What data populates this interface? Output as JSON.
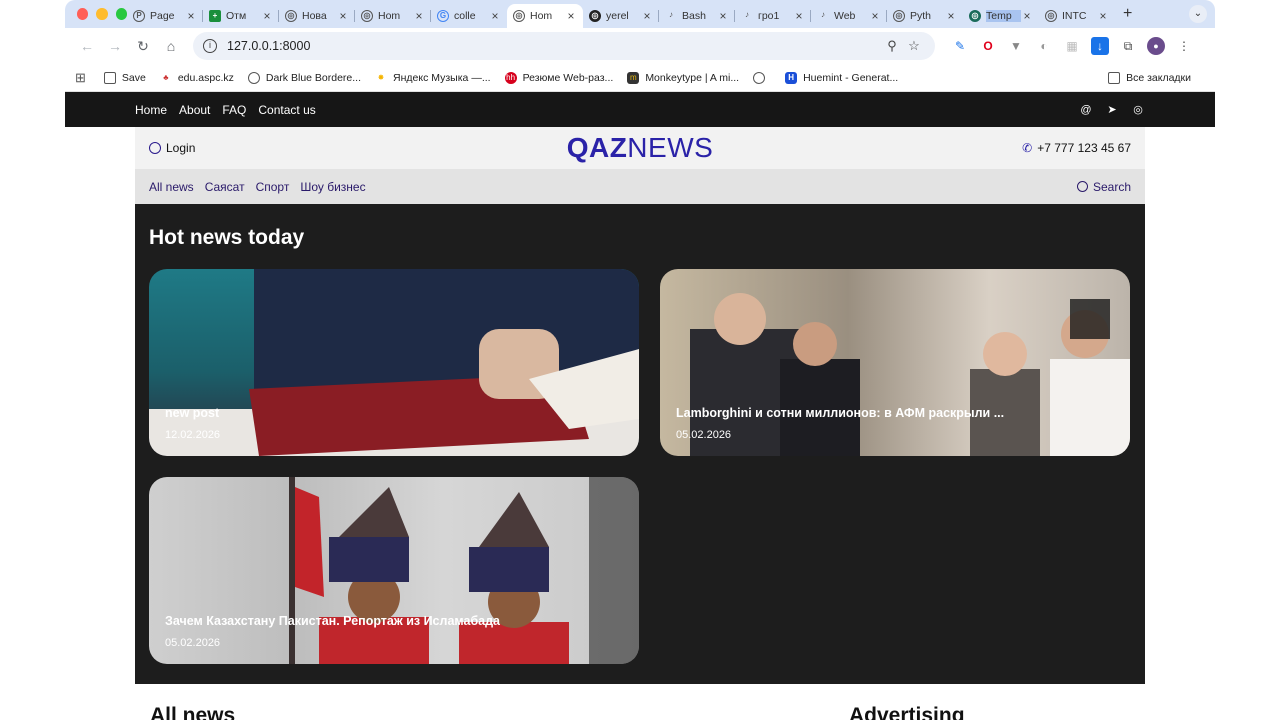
{
  "browser": {
    "tabs": [
      {
        "title": "Page",
        "icon": "P"
      },
      {
        "title": "Отм",
        "icon": "+"
      },
      {
        "title": "Нова",
        "icon": "◎"
      },
      {
        "title": "Hom",
        "icon": "◎"
      },
      {
        "title": "colle",
        "icon": "G"
      },
      {
        "title": "Hom",
        "icon": "◎"
      },
      {
        "title": "yerel",
        "icon": "◎"
      },
      {
        "title": "Bash",
        "icon": "♪"
      },
      {
        "title": "гро1",
        "icon": "♪"
      },
      {
        "title": "Web",
        "icon": "♪"
      },
      {
        "title": "Pyth",
        "icon": "◎"
      },
      {
        "title": "Temp",
        "icon": "◎"
      },
      {
        "title": "INTC",
        "icon": "◎"
      }
    ],
    "close_glyph": "×",
    "new_tab_glyph": "+",
    "url": "127.0.0.1:8000",
    "bookmarks": [
      {
        "label": "Save"
      },
      {
        "label": "edu.aspc.kz"
      },
      {
        "label": "Dark Blue Bordere..."
      },
      {
        "label": "Яндекс Музыка —..."
      },
      {
        "label": "Резюме Web-раз..."
      },
      {
        "label": "Monkeytype | A mi..."
      },
      {
        "label": ""
      },
      {
        "label": "Huemint - Generat..."
      }
    ],
    "all_bookmarks": "Все закладки"
  },
  "site": {
    "nav": [
      "Home",
      "About",
      "FAQ",
      "Contact us"
    ],
    "login": "Login",
    "logo_bold": "QAZ",
    "logo_thin": "NEWS",
    "phone": "+7 777 123 45 67",
    "categories": [
      "All news",
      "Саясат",
      "Спорт",
      "Шоу бизнес"
    ],
    "search": "Search",
    "hot_title": "Hot news today",
    "cards": [
      {
        "title": "new post",
        "date": "12.02.2026"
      },
      {
        "title": "Lamborghini и сотни миллионов: в АФМ раскрыли ...",
        "date": "05.02.2026"
      },
      {
        "title": "Зачем Казахстану Пакистан. Репортаж из Исламабада",
        "date": "05.02.2026"
      }
    ],
    "all_news": "All news",
    "advertising": "Advertising"
  }
}
